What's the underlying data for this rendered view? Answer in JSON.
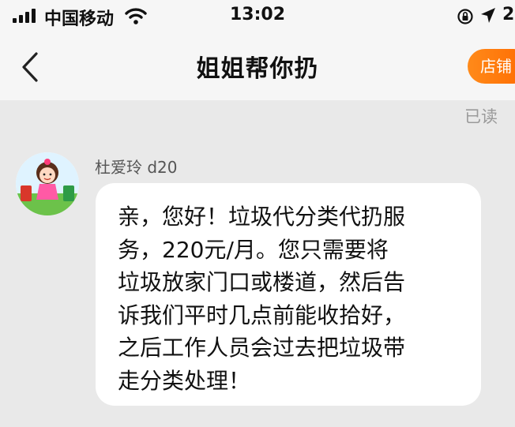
{
  "status_bar": {
    "carrier": "中国移动",
    "time": "13:02",
    "battery_text": "2"
  },
  "nav": {
    "title": "姐姐帮你扔",
    "store_button": "店铺"
  },
  "conversation": {
    "read_status": "已读",
    "messages": [
      {
        "sender": "杜爱玲 d20",
        "text": "亲，您好！垃圾代分类代扔服\n务，220元/月。您只需要将\n垃圾放家门口或楼道，然后告\n诉我们平时几点前能收拾好，\n之后工作人员会过去把垃圾带\n走分类处理！"
      }
    ]
  },
  "colors": {
    "accent": "#ff7a00",
    "background": "#e9e9e9",
    "bubble": "#ffffff"
  },
  "icons": [
    "signal-icon",
    "wifi-icon",
    "rotation-lock-icon",
    "location-icon",
    "back-chevron-icon"
  ]
}
